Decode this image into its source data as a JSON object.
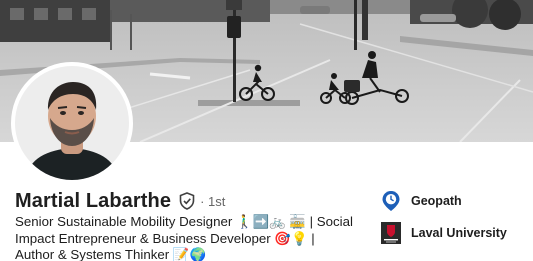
{
  "profile": {
    "name": "Martial Labarthe",
    "degree": "· 1st",
    "headline": "Senior Sustainable Mobility Designer 🚶‍♂️➡️🚲 🚋 | Social Impact Entrepreneur & Business Developer 🎯💡 | Author & Systems Thinker 📝🌍"
  },
  "organizations": [
    {
      "name": "Geopath",
      "icon": "location-pin-icon",
      "color": "#1d5fb8"
    },
    {
      "name": "Laval University",
      "icon": "university-shield-icon",
      "color": "#c8102e",
      "logo_text": "UNIVERSITÉ LAVAL"
    }
  ],
  "colors": {
    "text": "#1d1d1d",
    "muted": "#666666",
    "accent_blue": "#1d5fb8",
    "laval_red": "#c8102e"
  }
}
